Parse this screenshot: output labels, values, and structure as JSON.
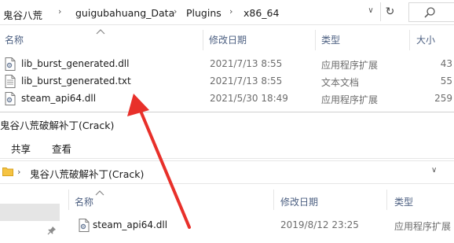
{
  "top": {
    "breadcrumb": [
      "鬼谷八荒",
      "guigubahuang_Data",
      "Plugins",
      "x86_64"
    ],
    "columns": {
      "name": "名称",
      "modified": "修改日期",
      "type": "类型",
      "size": "大小"
    },
    "files": [
      {
        "name": "lib_burst_generated.dll",
        "modified": "2021/7/13 8:55",
        "type": "应用程序扩展",
        "size": "43",
        "icon": "dll-file-icon"
      },
      {
        "name": "lib_burst_generated.txt",
        "modified": "2021/7/13 8:55",
        "type": "文本文档",
        "size": "55",
        "icon": "text-file-icon"
      },
      {
        "name": "steam_api64.dll",
        "modified": "2021/5/30 18:49",
        "type": "应用程序扩展",
        "size": "259",
        "icon": "dll-file-icon"
      }
    ]
  },
  "bottom": {
    "title": "鬼谷八荒破解补丁(Crack)",
    "ribbon_tabs": [
      "共享",
      "查看"
    ],
    "address": "鬼谷八荒破解补丁(Crack)",
    "columns": {
      "name": "名称",
      "modified": "修改日期",
      "type": "类型"
    },
    "files": [
      {
        "name": "steam_api64.dll",
        "modified": "2019/8/12 23:25",
        "type": "应用程序扩展",
        "icon": "dll-file-icon"
      }
    ]
  },
  "annotation": {
    "color": "#e8302a"
  }
}
